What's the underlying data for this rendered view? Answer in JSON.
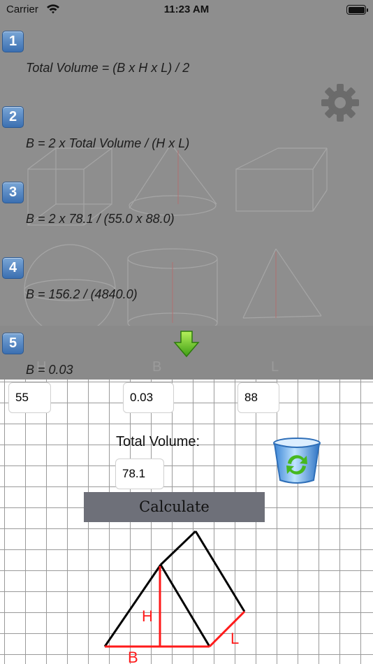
{
  "status_bar": {
    "carrier": "Carrier",
    "time": "11:23 AM"
  },
  "steps": [
    {
      "number": "1",
      "text": "Total Volume = (B x H x L) / 2"
    },
    {
      "number": "2",
      "text": "B = 2 x Total Volume / (H x L)"
    },
    {
      "number": "3",
      "text": "B = 2 x 78.1 / (55.0 x 88.0)"
    },
    {
      "number": "4",
      "text": "B = 156.2 / (4840.0)"
    },
    {
      "number": "5",
      "text": "B = 0.03"
    }
  ],
  "hint_labels": {
    "h": "H",
    "b": "B",
    "l": "L"
  },
  "inputs": {
    "h_value": "55",
    "b_value": "0.03",
    "l_value": "88",
    "total_volume_value": "78.1"
  },
  "total_volume_label": "Total Volume:",
  "calculate_label": "Calculate",
  "diagram_labels": {
    "h": "H",
    "b": "B",
    "l": "L"
  },
  "colors": {
    "accent_red": "#ff1a1a",
    "overlay_grey": "#8e8e8e",
    "button_grey": "#6e7079"
  },
  "icons": {
    "settings": "gear-icon",
    "arrow": "arrow-down-icon",
    "clear": "recycle-bin-icon"
  }
}
